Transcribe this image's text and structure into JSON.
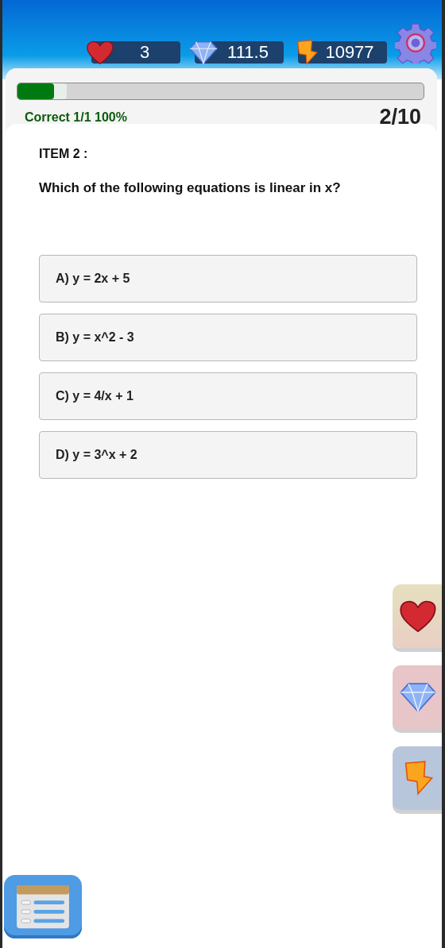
{
  "counters": [
    {
      "kind": "heart",
      "value": "3"
    },
    {
      "kind": "gem",
      "value": "111.5"
    },
    {
      "kind": "bolt",
      "value": "10977"
    }
  ],
  "progress": {
    "level": 0.09,
    "correct": "Correct 1/1  100%",
    "position": "2/10"
  },
  "question": {
    "label": "ITEM 2 :",
    "text": "Which of the following equations is linear in x?"
  },
  "options": [
    {
      "text": "A) y = 2x + 5"
    },
    {
      "text": "B) y = x^2 - 3"
    },
    {
      "text": "C) y = 4/x + 1"
    },
    {
      "text": "D) y = 3^x + 2"
    }
  ],
  "side_buttons": [
    {
      "kind": "heart"
    },
    {
      "kind": "gem"
    },
    {
      "kind": "bolt"
    }
  ]
}
